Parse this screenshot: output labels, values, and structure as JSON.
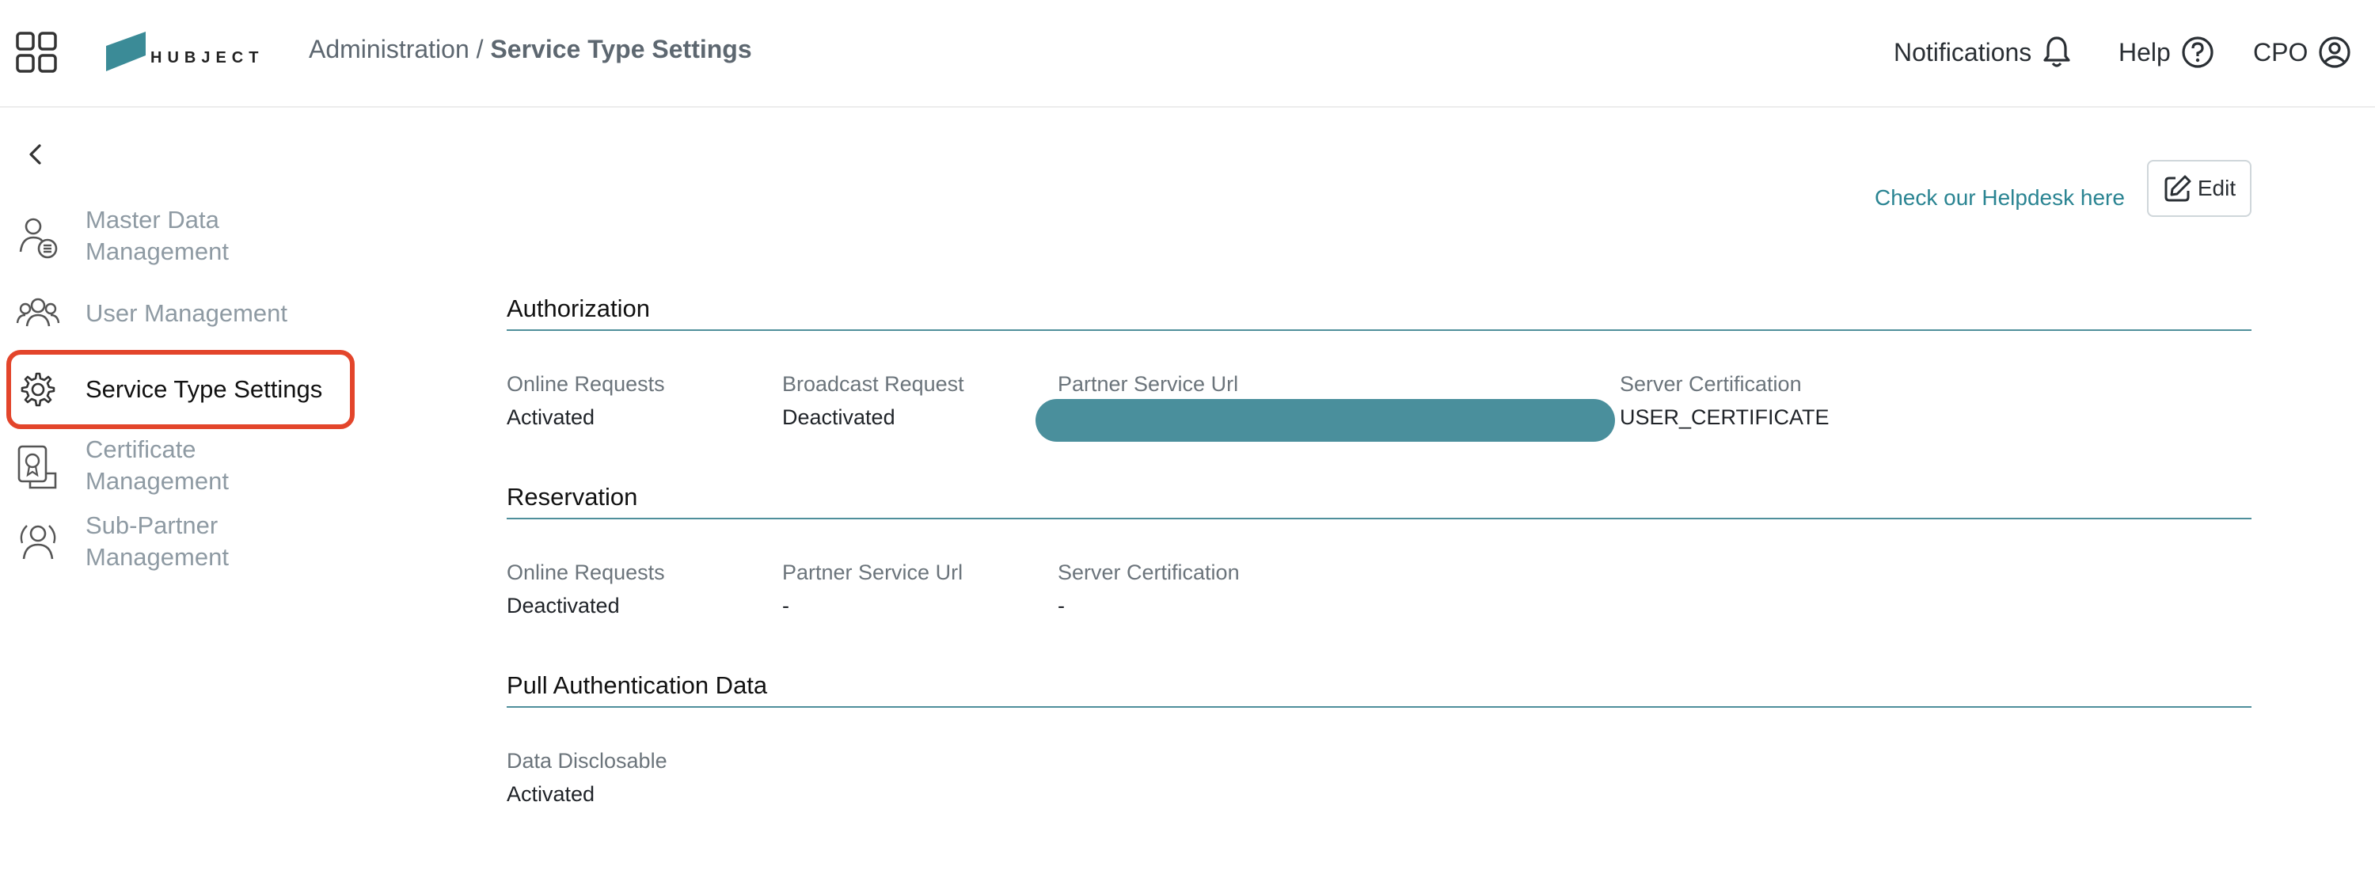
{
  "header": {
    "logo_text": "HUBJECT",
    "breadcrumb": {
      "parent": "Administration",
      "separator": " / ",
      "current": "Service Type Settings"
    },
    "actions": {
      "notifications": "Notifications",
      "help": "Help",
      "user": "CPO"
    }
  },
  "sidebar": {
    "items": [
      {
        "label_line1": "Master Data",
        "label_line2": "Management",
        "icon": "master-data-icon",
        "active": false
      },
      {
        "label_line1": "User Management",
        "label_line2": "",
        "icon": "users-icon",
        "active": false
      },
      {
        "label_line1": "Service Type Settings",
        "label_line2": "",
        "icon": "gear-icon",
        "active": true
      },
      {
        "label_line1": "Certificate",
        "label_line2": "Management",
        "icon": "certificate-icon",
        "active": false
      },
      {
        "label_line1": "Sub-Partner",
        "label_line2": "Management",
        "icon": "sub-partner-icon",
        "active": false
      }
    ]
  },
  "main": {
    "helpdesk_link": "Check our Helpdesk here",
    "edit_label": "Edit",
    "sections": {
      "authorization": {
        "title": "Authorization",
        "fields": [
          {
            "label": "Online Requests",
            "value": "Activated"
          },
          {
            "label": "Broadcast Request",
            "value": "Deactivated"
          },
          {
            "label": "Partner Service Url",
            "value": ""
          },
          {
            "label": "Server Certification",
            "value": "USER_CERTIFICATE"
          }
        ]
      },
      "reservation": {
        "title": "Reservation",
        "fields": [
          {
            "label": "Online Requests",
            "value": "Deactivated"
          },
          {
            "label": "Partner Service Url",
            "value": "-"
          },
          {
            "label": "Server Certification",
            "value": "-"
          }
        ]
      },
      "pull_auth": {
        "title": "Pull Authentication Data",
        "fields": [
          {
            "label": "Data Disclosable",
            "value": "Activated"
          }
        ]
      }
    }
  },
  "colors": {
    "accent": "#2a8492",
    "rule": "#4f8f9b",
    "redaction": "#4a8f9c",
    "highlight_box": "#e3452b",
    "muted_text": "#8e9aa3"
  }
}
